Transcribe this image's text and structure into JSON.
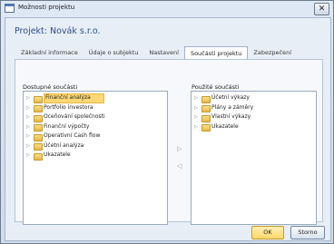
{
  "window": {
    "title": "Možnosti projektu",
    "close_glyph": "✕"
  },
  "heading": "Projekt: Novák s.r.o.",
  "tabs": [
    {
      "label": "Základní informace",
      "active": false
    },
    {
      "label": "Údaje o subjektu",
      "active": false
    },
    {
      "label": "Nastavení",
      "active": false
    },
    {
      "label": "Součásti projektu",
      "active": true
    },
    {
      "label": "Zabezpečení",
      "active": false
    }
  ],
  "available": {
    "label": "Dostupné součásti",
    "items": [
      {
        "label": "Finanční analýza",
        "selected": true
      },
      {
        "label": "Portfolio investora",
        "selected": false
      },
      {
        "label": "Oceňování společnosti",
        "selected": false
      },
      {
        "label": "Finanční výpočty",
        "selected": false
      },
      {
        "label": "Operativní Cash flow",
        "selected": false
      },
      {
        "label": "Účetní analýza",
        "selected": false
      },
      {
        "label": "Ukazatele",
        "selected": false
      }
    ]
  },
  "used": {
    "label": "Použité součásti",
    "items": [
      {
        "label": "Účetní výkazy"
      },
      {
        "label": "Plány a záměry"
      },
      {
        "label": "Vlastní výkazy"
      },
      {
        "label": "Ukazatele"
      }
    ]
  },
  "move_right_glyph": "▷",
  "move_left_glyph": "◁",
  "expander_glyph": "▷",
  "buttons": {
    "ok": "OK",
    "cancel": "Storno"
  },
  "colors": {
    "accent_title": "#2c5086",
    "selection": "#fcd775",
    "folder": "#e4b848"
  },
  "icons": {
    "window": "window-app-icon",
    "folder": "folder-icon",
    "expander": "tree-expander-icon"
  }
}
